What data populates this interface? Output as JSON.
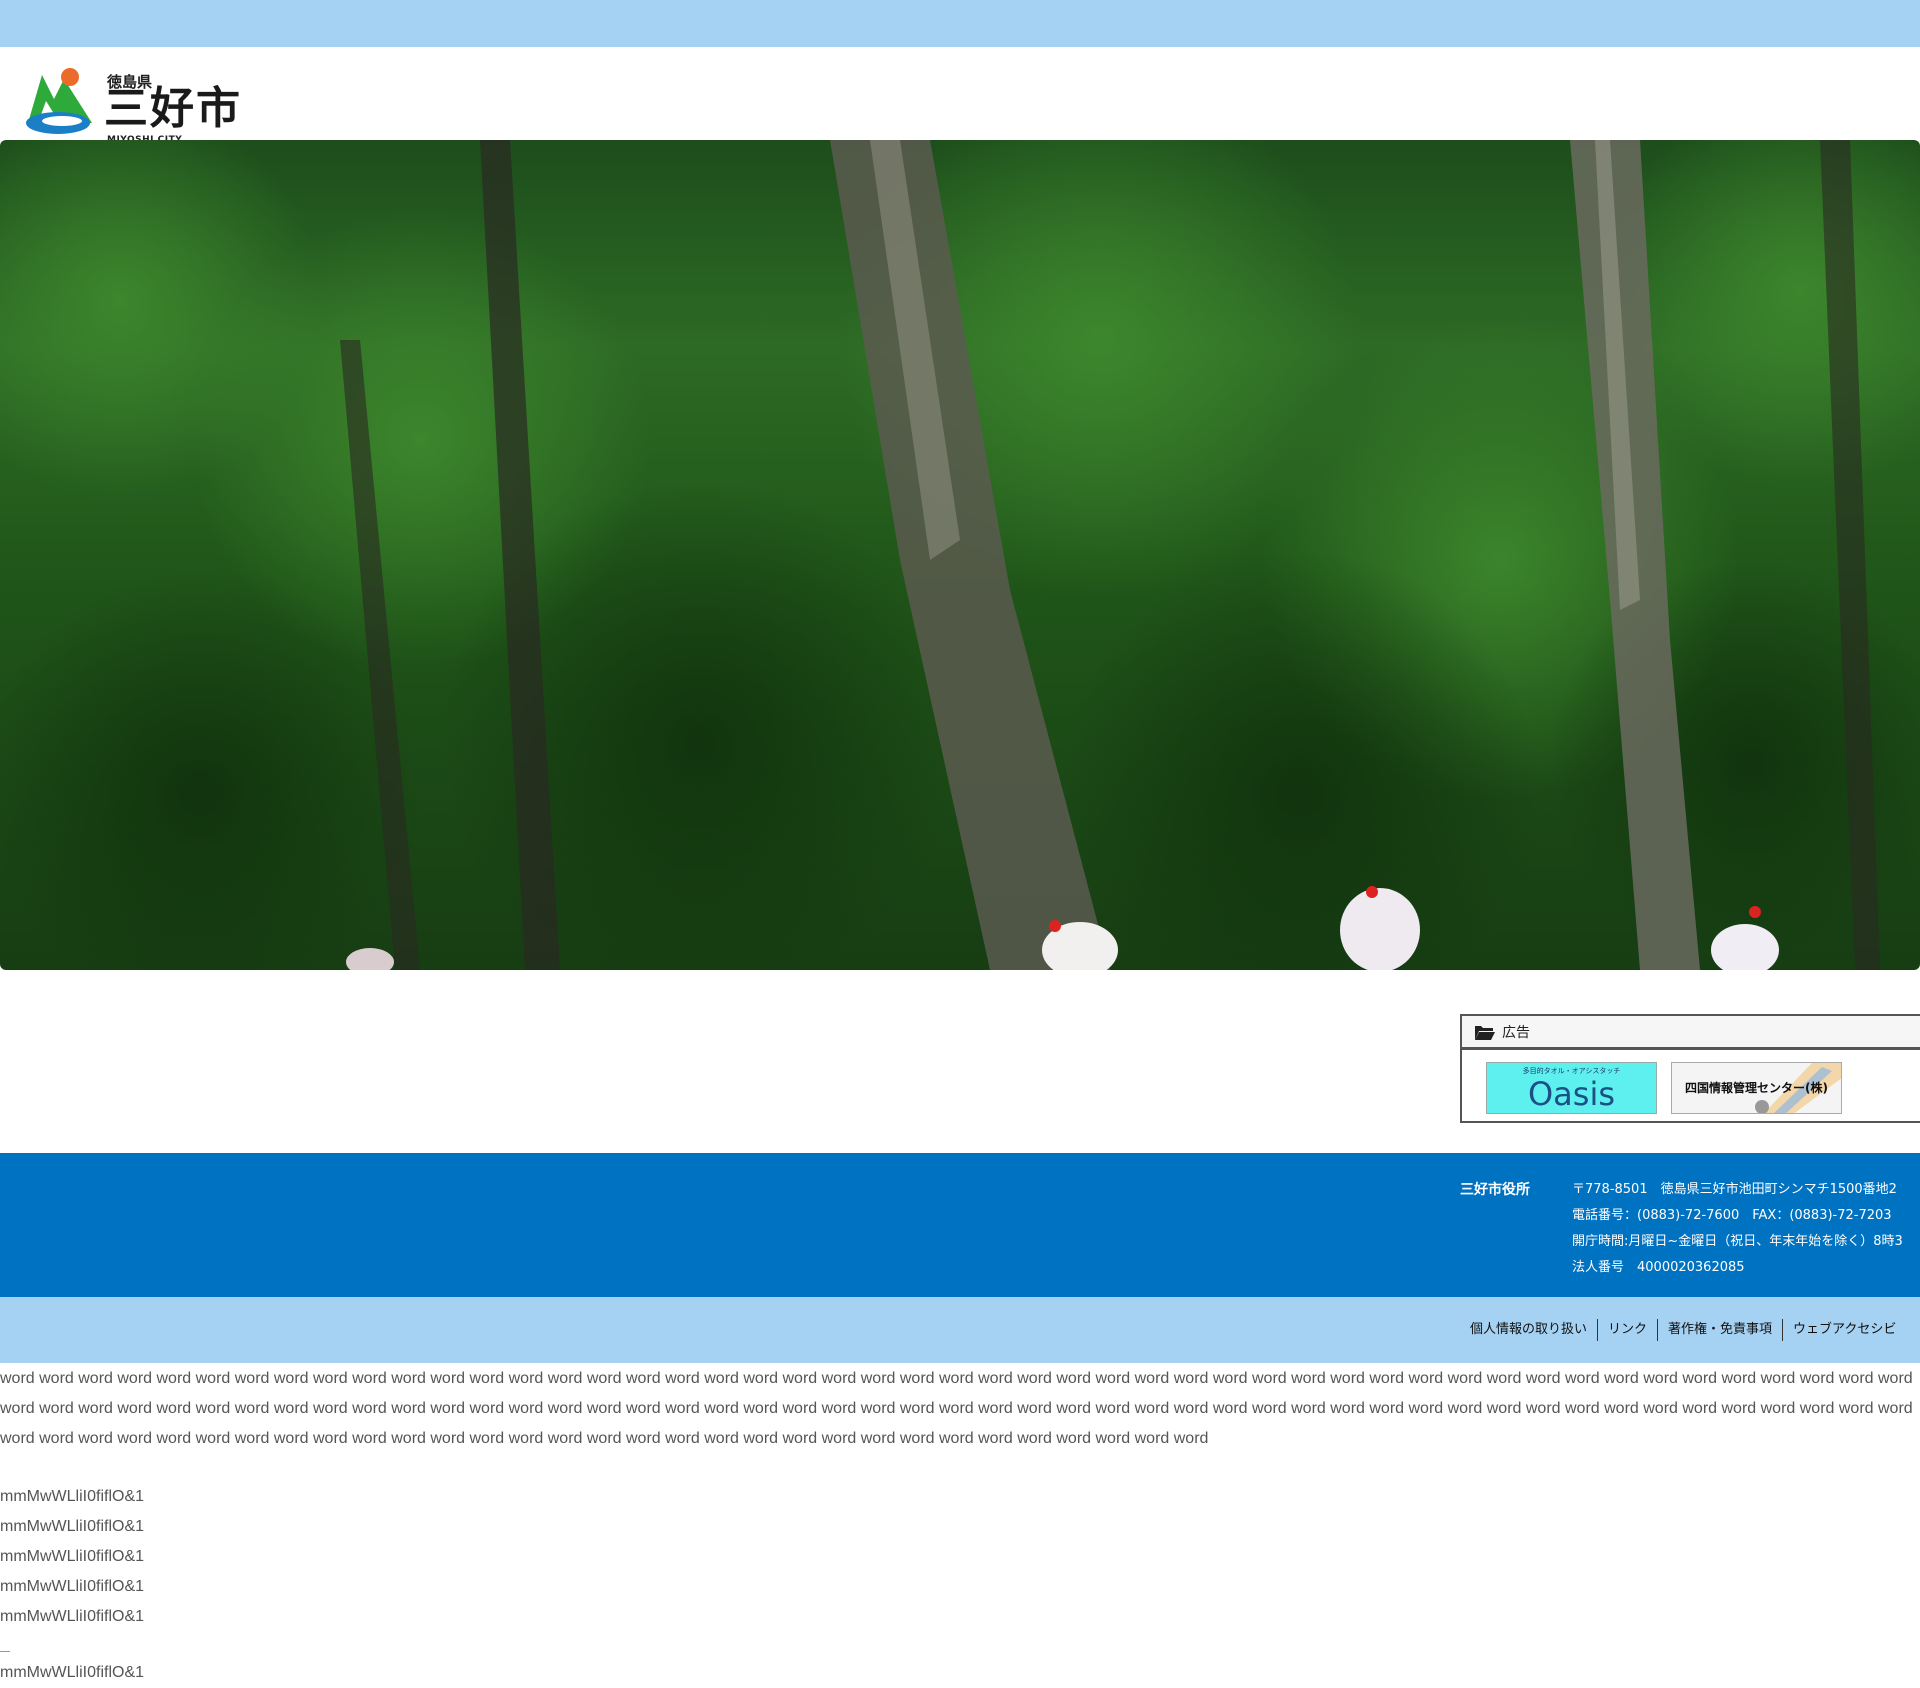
{
  "header": {
    "logo_pref": "徳島県",
    "logo_city": "三好市",
    "logo_en": "MIYOSHI CITY"
  },
  "ads": {
    "title": "広告",
    "banner1_sub": "多目的タオル・オアシスタッチ",
    "banner1_main": "Oasis Touch",
    "banner2_text": "四国情報管理センター(株)"
  },
  "footer": {
    "office_name": "三好市役所",
    "address": "〒778-8501　徳島県三好市池田町シンマチ1500番地2",
    "phone": "電話番号：(0883)-72-7600　FAX：(0883)-72-7203",
    "hours": "開庁時間:月曜日~金曜日（祝日、年末年始を除く）8時3",
    "corp_number": "法人番号　4000020362085",
    "links": [
      "個人情報の取り扱い",
      "リンク",
      "著作権・免責事項",
      "ウェブアクセシビ"
    ]
  },
  "filler": {
    "word_text": "word word word word word word word word word word word word word word word word word word word word word word word word word word word word word word word word word word word word word word word word word word word word word word word word word word word word word word word word word word word word word word word word word word word word word word word word word word word word word word word word word word word word word word word word word word word word word word word word word word word word word word word word word word word word word word word word word word word word word word word word word word word word word word word word word",
    "m_lines": [
      "mmMwWLliI0fiflO&1",
      "mmMwWLliI0fiflO&1",
      "mmMwWLliI0fiflO&1",
      "mmMwWLliI0fiflO&1",
      "mmMwWLliI0fiflO&1"
    ],
    "m_last": "mmMwWLliI0fiflO&1"
  },
  "colors": {
    "top_bar": "#a5d1f2",
    "footer_blue": "#0072c2",
    "footer_links_bg": "#a5d1f2",
    "banner_oasis_bg": "#5ef0ef"
  }
}
